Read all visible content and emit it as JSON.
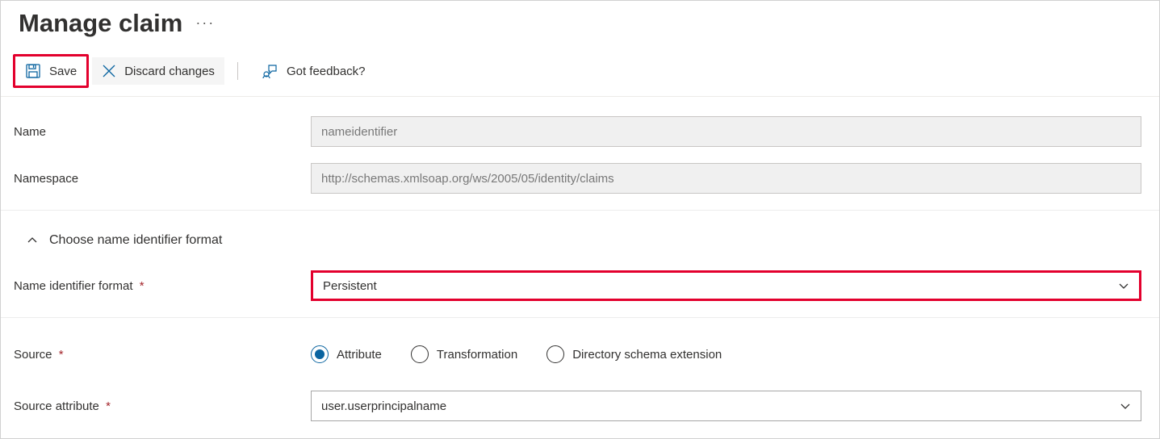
{
  "header": {
    "title": "Manage claim"
  },
  "toolbar": {
    "save_label": "Save",
    "discard_label": "Discard changes",
    "feedback_label": "Got feedback?"
  },
  "form": {
    "name": {
      "label": "Name",
      "value": "nameidentifier"
    },
    "namespace": {
      "label": "Namespace",
      "value": "http://schemas.xmlsoap.org/ws/2005/05/identity/claims"
    },
    "section_toggle_label": "Choose name identifier format",
    "name_identifier_format": {
      "label": "Name identifier format",
      "value": "Persistent"
    },
    "source": {
      "label": "Source",
      "options": {
        "attribute": "Attribute",
        "transformation": "Transformation",
        "directory": "Directory schema extension"
      },
      "selected": "attribute"
    },
    "source_attribute": {
      "label": "Source attribute",
      "value": "user.userprincipalname"
    }
  }
}
